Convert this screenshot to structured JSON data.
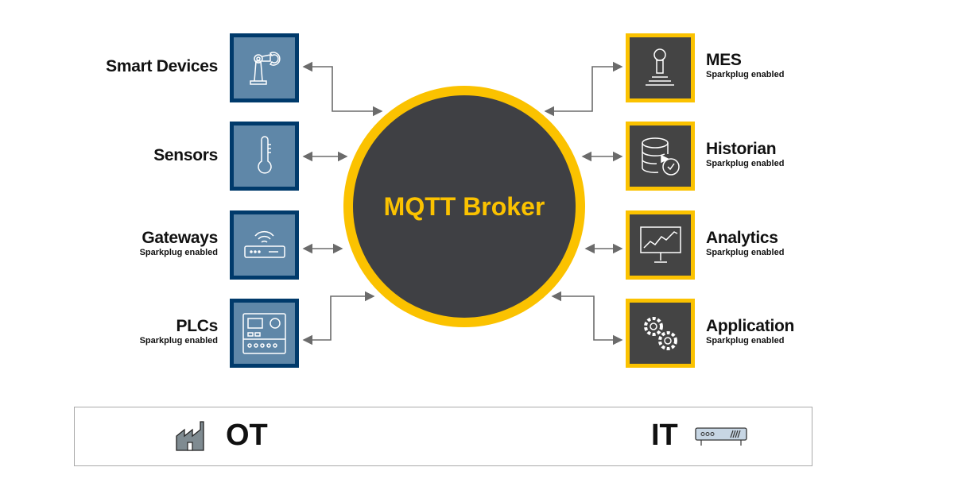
{
  "broker": {
    "label": "MQTT Broker"
  },
  "colors": {
    "ot_border": "#003a6b",
    "ot_fill": "#5f87a8",
    "it_border": "#fbc200",
    "it_fill": "#444444",
    "broker_ring": "#fbc200",
    "broker_fill": "#3f4044"
  },
  "ot_nodes": [
    {
      "title": "Smart Devices",
      "subtitle": "",
      "icon": "robot-arm-icon"
    },
    {
      "title": "Sensors",
      "subtitle": "",
      "icon": "thermometer-icon"
    },
    {
      "title": "Gateways",
      "subtitle": "Sparkplug enabled",
      "icon": "wifi-router-icon"
    },
    {
      "title": "PLCs",
      "subtitle": "Sparkplug enabled",
      "icon": "plc-controller-icon"
    }
  ],
  "it_nodes": [
    {
      "title": "MES",
      "subtitle": "Sparkplug enabled",
      "icon": "joystick-icon"
    },
    {
      "title": "Historian",
      "subtitle": "Sparkplug enabled",
      "icon": "database-clock-icon"
    },
    {
      "title": "Analytics",
      "subtitle": "Sparkplug enabled",
      "icon": "monitor-chart-icon"
    },
    {
      "title": "Application",
      "subtitle": "Sparkplug enabled",
      "icon": "gears-icon"
    }
  ],
  "band": {
    "ot_label": "OT",
    "it_label": "IT",
    "ot_icon": "factory-icon",
    "it_icon": "server-icon"
  }
}
